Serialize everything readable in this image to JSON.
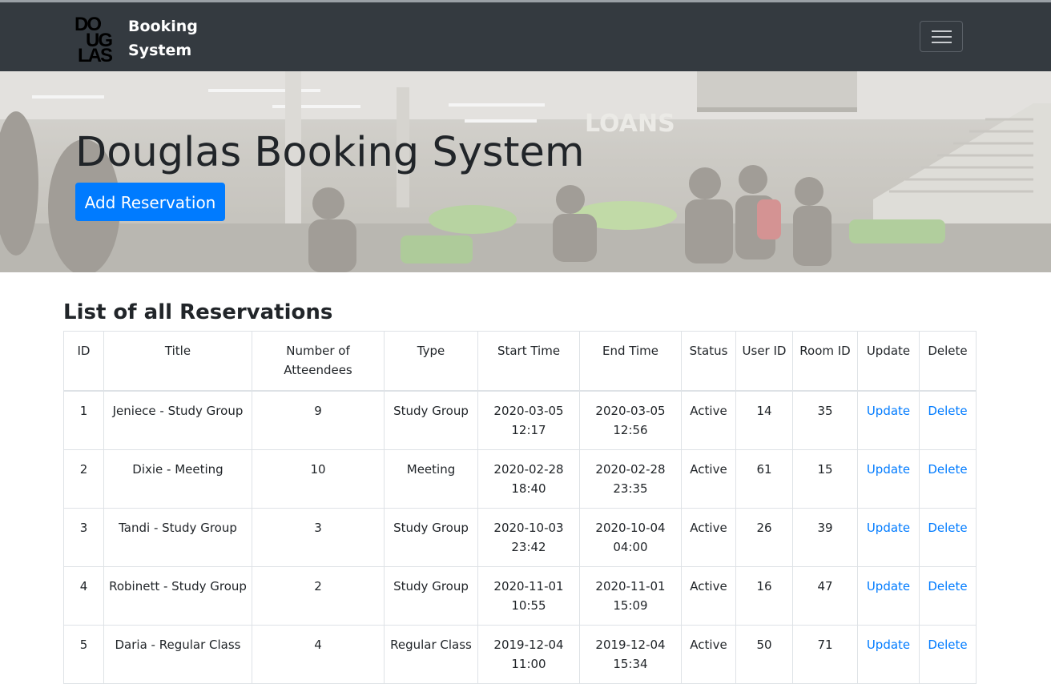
{
  "navbar": {
    "brand_line1": "Booking",
    "brand_line2": "System",
    "logo_text": "DOUGLAS",
    "toggler_icon": "hamburger-icon"
  },
  "hero": {
    "title": "Douglas Booking System",
    "add_button": "Add Reservation",
    "background_sign": "LOANS"
  },
  "reservations": {
    "heading": "List of all Reservations",
    "columns": [
      "ID",
      "Title",
      "Number of Atteendees",
      "Type",
      "Start Time",
      "End Time",
      "Status",
      "User ID",
      "Room ID",
      "Update",
      "Delete"
    ],
    "rows": [
      {
        "id": "1",
        "title": "Jeniece - Study Group",
        "attendees": "9",
        "type": "Study Group",
        "start": "2020-03-05 12:17",
        "end": "2020-03-05 12:56",
        "status": "Active",
        "user_id": "14",
        "room_id": "35",
        "update": "Update",
        "delete": "Delete"
      },
      {
        "id": "2",
        "title": "Dixie - Meeting",
        "attendees": "10",
        "type": "Meeting",
        "start": "2020-02-28 18:40",
        "end": "2020-02-28 23:35",
        "status": "Active",
        "user_id": "61",
        "room_id": "15",
        "update": "Update",
        "delete": "Delete"
      },
      {
        "id": "3",
        "title": "Tandi - Study Group",
        "attendees": "3",
        "type": "Study Group",
        "start": "2020-10-03 23:42",
        "end": "2020-10-04 04:00",
        "status": "Active",
        "user_id": "26",
        "room_id": "39",
        "update": "Update",
        "delete": "Delete"
      },
      {
        "id": "4",
        "title": "Robinett - Study Group",
        "attendees": "2",
        "type": "Study Group",
        "start": "2020-11-01 10:55",
        "end": "2020-11-01 15:09",
        "status": "Active",
        "user_id": "16",
        "room_id": "47",
        "update": "Update",
        "delete": "Delete"
      },
      {
        "id": "5",
        "title": "Daria - Regular Class",
        "attendees": "4",
        "type": "Regular Class",
        "start": "2019-12-04 11:00",
        "end": "2019-12-04 15:34",
        "status": "Active",
        "user_id": "50",
        "room_id": "71",
        "update": "Update",
        "delete": "Delete"
      }
    ]
  },
  "colors": {
    "navbar_bg": "#343a40",
    "primary": "#007bff",
    "text": "#212529",
    "border": "#dee2e6"
  }
}
